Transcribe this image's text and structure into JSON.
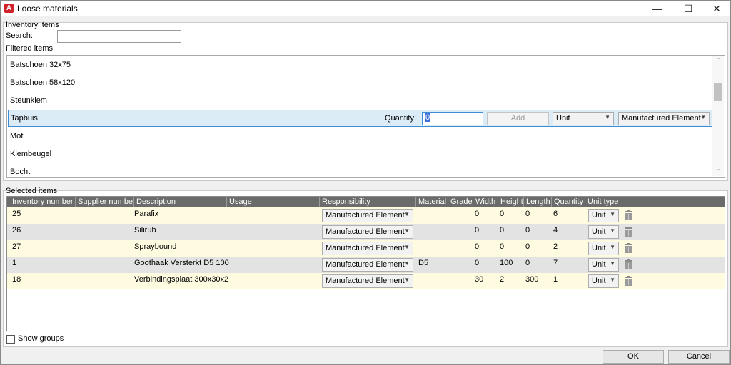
{
  "window": {
    "title": "Loose materials",
    "app_icon": "autocad-app-icon",
    "minimize_glyph": "—",
    "maximize_glyph": "☐",
    "close_glyph": "✕"
  },
  "inventory": {
    "group_label": "Inventory items",
    "search_label": "Search:",
    "search_value": "",
    "filtered_label": "Filtered items:",
    "items": [
      {
        "name": "Batschoen 32x75"
      },
      {
        "name": "Batschoen 58x120"
      },
      {
        "name": "Steunklem"
      },
      {
        "name": "Tapbuis"
      },
      {
        "name": "Mof"
      },
      {
        "name": "Klembeugel"
      },
      {
        "name": "Bocht"
      }
    ],
    "selected_row": {
      "quantity_label": "Quantity:",
      "quantity_value": "0",
      "add_label": "Add",
      "unit_value": "Unit",
      "responsibility_value": "Manufactured Element"
    },
    "scroll_up_glyph": "⌃",
    "scroll_down_glyph": "⌄"
  },
  "selected": {
    "group_label": "Selected items",
    "columns": [
      "Inventory number",
      "Supplier number",
      "Description",
      "Usage",
      "Responsibility",
      "Material",
      "Grade",
      "Width",
      "Height",
      "Length",
      "Quantity",
      "Unit type"
    ],
    "rows": [
      {
        "inventory_number": "25",
        "supplier_number": "",
        "description": "Parafix",
        "usage": "",
        "responsibility": "Manufactured Element",
        "material": "",
        "grade": "",
        "width": "0",
        "height": "0",
        "length": "0",
        "quantity": "6",
        "unit_type": "Unit"
      },
      {
        "inventory_number": "26",
        "supplier_number": "",
        "description": "Silirub",
        "usage": "",
        "responsibility": "Manufactured Element",
        "material": "",
        "grade": "",
        "width": "0",
        "height": "0",
        "length": "0",
        "quantity": "4",
        "unit_type": "Unit"
      },
      {
        "inventory_number": "27",
        "supplier_number": "",
        "description": "Spraybound",
        "usage": "",
        "responsibility": "Manufactured Element",
        "material": "",
        "grade": "",
        "width": "0",
        "height": "0",
        "length": "0",
        "quantity": "2",
        "unit_type": "Unit"
      },
      {
        "inventory_number": "1",
        "supplier_number": "",
        "description": "Goothaak Versterkt D5 100",
        "usage": "",
        "responsibility": "Manufactured Element",
        "material": "D5",
        "grade": "",
        "width": "0",
        "height": "100",
        "length": "0",
        "quantity": "7",
        "unit_type": "Unit"
      },
      {
        "inventory_number": "18",
        "supplier_number": "",
        "description": "Verbindingsplaat 300x30x2",
        "usage": "",
        "responsibility": "Manufactured Element",
        "material": "",
        "grade": "",
        "width": "30",
        "height": "2",
        "length": "300",
        "quantity": "1",
        "unit_type": "Unit"
      }
    ]
  },
  "footer": {
    "show_groups_label": "Show groups",
    "show_groups_checked": false,
    "ok_label": "OK",
    "cancel_label": "Cancel"
  },
  "colors": {
    "selection_border": "#3c8dd6",
    "selection_fill": "#dcecf7",
    "header_bg": "#6b6b6b",
    "row_odd": "#fffbe0",
    "row_even": "#e3e3e3",
    "app_icon": "#d0202a"
  }
}
